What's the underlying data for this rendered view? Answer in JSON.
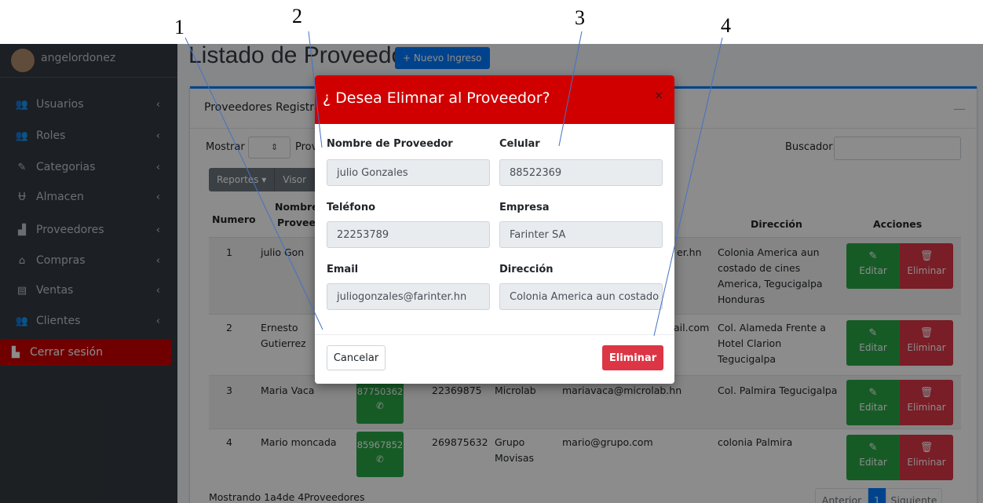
{
  "sidebar": {
    "username": "angelordonez",
    "items": [
      {
        "label": "Usuarios",
        "icon": "users-icon"
      },
      {
        "label": "Roles",
        "icon": "roles-icon"
      },
      {
        "label": "Categorias",
        "icon": "categories-icon"
      },
      {
        "label": "Almacen",
        "icon": "warehouse-icon"
      },
      {
        "label": "Proveedores",
        "icon": "industry-icon"
      },
      {
        "label": "Compras",
        "icon": "shop-icon"
      },
      {
        "label": "Ventas",
        "icon": "cash-register-icon"
      },
      {
        "label": "Clientes",
        "icon": "clients-icon"
      }
    ],
    "logout_label": "Cerrar sesión"
  },
  "page": {
    "title": "Listado de Proveedores",
    "new_button": "+ Nuevo Ingreso"
  },
  "card": {
    "title": "Proveedores Registrados",
    "mostrar_label": "Mostrar",
    "length_value": "",
    "prov_word": "Prove",
    "buscador_label": "Buscador:",
    "reportes_label": "Reportes ▾",
    "visor_label": "Visor"
  },
  "table": {
    "headers": {
      "numero": "Numero",
      "nombre1": "Nombre",
      "nombre2": "Provee",
      "direccion": "Dirección",
      "acciones": "Acciones"
    },
    "rows": [
      {
        "num": "1",
        "name": "julio Gon",
        "email_tail": "er.hn",
        "dir": [
          "Colonia America aun",
          "costado de cines",
          "America, Tegucigalpa",
          "Honduras"
        ]
      },
      {
        "num": "2",
        "name": "Ernesto",
        "name2": "Gutierrez",
        "email_tail": "ail.com",
        "dir": [
          "Col. Alameda Frente a",
          "Hotel Clarion",
          "Tegucigalpa"
        ]
      },
      {
        "num": "3",
        "name": "Maria Vaca",
        "cel": "87750362",
        "tel": "22369875",
        "company": "Microlab",
        "email": "mariavaca@microlab.hn",
        "dir": [
          "Col. Palmira Tegucigalpa"
        ]
      },
      {
        "num": "4",
        "name": "Mario moncada",
        "cel": "85967852",
        "tel": "269875632",
        "company": "Grupo",
        "company2": "Movisas",
        "email": "mario@grupo.com",
        "dir": [
          "colonia Palmira"
        ]
      }
    ],
    "edit_label": "Editar",
    "delete_label": "Eliminar"
  },
  "footer": {
    "info": "Mostrando 1a4de 4Proveedores",
    "prev": "Anterior",
    "page": "1",
    "next": "Siguiente"
  },
  "modal": {
    "title": "¿ Desea Elimnar al Proveedor?",
    "close": "×",
    "fields": {
      "nombre_label": "Nombre de Proveedor",
      "nombre_value": "julio Gonzales",
      "celular_label": "Celular",
      "celular_value": "88522369",
      "telefono_label": "Teléfono",
      "telefono_value": "22253789",
      "empresa_label": "Empresa",
      "empresa_value": "Farinter  SA",
      "email_label": "Email",
      "email_value": "juliogonzales@farinter.hn",
      "direccion_label": "Dirección",
      "direccion_value": "Colonia America aun costado c"
    },
    "cancel_label": "Cancelar",
    "delete_label": "Eliminar"
  },
  "callouts": [
    "1",
    "2",
    "3",
    "4"
  ]
}
